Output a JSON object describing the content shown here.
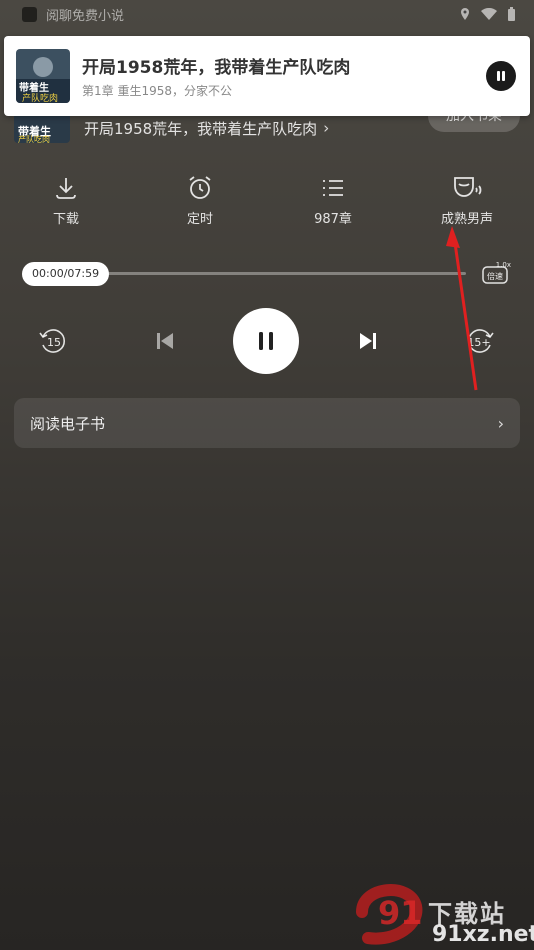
{
  "status_bar": {
    "app_name": "阅聊免费小说"
  },
  "notification": {
    "title": "开局1958荒年，我带着生产队吃肉",
    "subtitle": "第1章 重生1958，分家不公"
  },
  "book": {
    "title": "开局1958荒年，我带着生产队吃肉",
    "chevron": "›",
    "bookshelf_button": "加入书架",
    "cover_text": "带着生产队吃肉"
  },
  "actions": [
    {
      "label": "下载",
      "icon": "download-icon"
    },
    {
      "label": "定时",
      "icon": "alarm-clock-icon"
    },
    {
      "label": "987章",
      "icon": "list-icon"
    },
    {
      "label": "成熟男声",
      "icon": "voice-icon"
    }
  ],
  "player": {
    "time": "00:00/07:59",
    "progress": 0.0,
    "speed_value": "1.0x",
    "speed_label": "倍速",
    "rewind_label": "15",
    "forward_label": "15+"
  },
  "read_ebook": {
    "label": "阅读电子书",
    "chevron": "›"
  },
  "watermark": {
    "site": "91xz.net",
    "name": "下载站"
  },
  "colors": {
    "arrow": "#e02020",
    "accent": "#ffffff"
  }
}
